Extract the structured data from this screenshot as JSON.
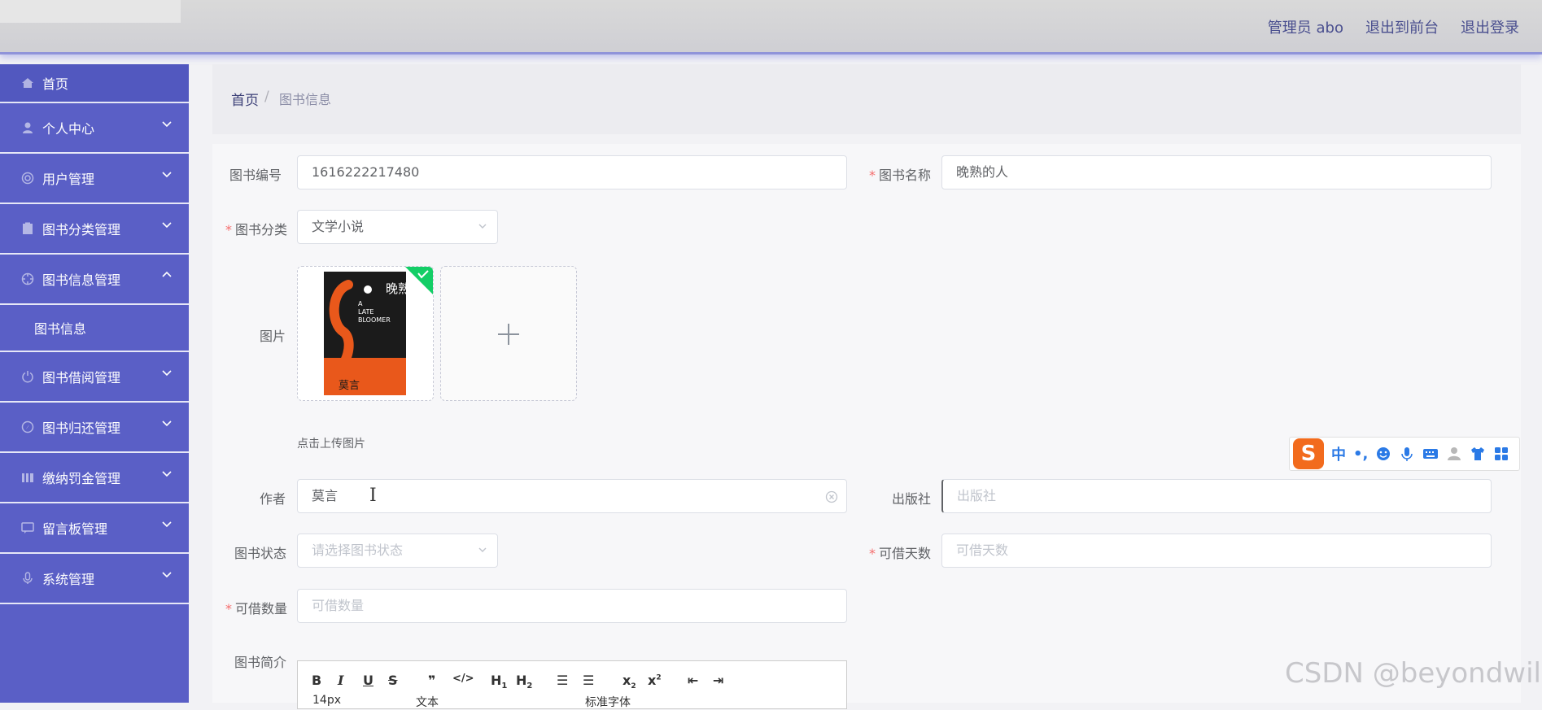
{
  "header": {
    "user_label": "管理员 abo",
    "front_label": "退出到前台",
    "logout_label": "退出登录"
  },
  "sidebar": {
    "items": [
      {
        "label": "首页",
        "icon": "home-icon"
      },
      {
        "label": "个人中心",
        "icon": "person-icon"
      },
      {
        "label": "用户管理",
        "icon": "user-circle-icon"
      },
      {
        "label": "图书分类管理",
        "icon": "clipboard-icon"
      },
      {
        "label": "图书信息管理",
        "icon": "target-icon"
      },
      {
        "label": "图书借阅管理",
        "icon": "power-icon"
      },
      {
        "label": "图书归还管理",
        "icon": "compass-icon"
      },
      {
        "label": "缴纳罚金管理",
        "icon": "bars-icon"
      },
      {
        "label": "留言板管理",
        "icon": "chat-icon"
      },
      {
        "label": "系统管理",
        "icon": "mic-icon"
      }
    ],
    "submenu_label": "图书信息"
  },
  "breadcrumb": {
    "home": "首页",
    "separator": "/",
    "current": "图书信息"
  },
  "form": {
    "book_no_label": "图书编号",
    "book_no_value": "1616222217480",
    "book_name_label": "图书名称",
    "book_name_value": "晚熟的人",
    "category_label": "图书分类",
    "category_value": "文学小说",
    "image_label": "图片",
    "upload_hint": "点击上传图片",
    "author_label": "作者",
    "author_value": "莫言",
    "publisher_label": "出版社",
    "publisher_placeholder": "出版社",
    "status_label": "图书状态",
    "status_placeholder": "请选择图书状态",
    "days_label": "可借天数",
    "days_placeholder": "可借天数",
    "qty_label": "可借数量",
    "qty_placeholder": "可借数量",
    "intro_label": "图书简介",
    "required_mark": "*"
  },
  "book_cover": {
    "title_main": "晚熟的人",
    "title_en_1": "A",
    "title_en_2": "LATE",
    "title_en_3": "BLOOMER",
    "author": "莫言"
  },
  "ime": {
    "logo": "S",
    "mode": "中",
    "punct": "•,"
  },
  "editor": {
    "font_size": "14px",
    "text_style": "文本",
    "font_family": "标准字体"
  },
  "watermark": "CSDN @beyondwild",
  "colors": {
    "sidebar": "#5a5fc6",
    "required": "#f56c6c",
    "header_text": "#4a4f8f"
  }
}
